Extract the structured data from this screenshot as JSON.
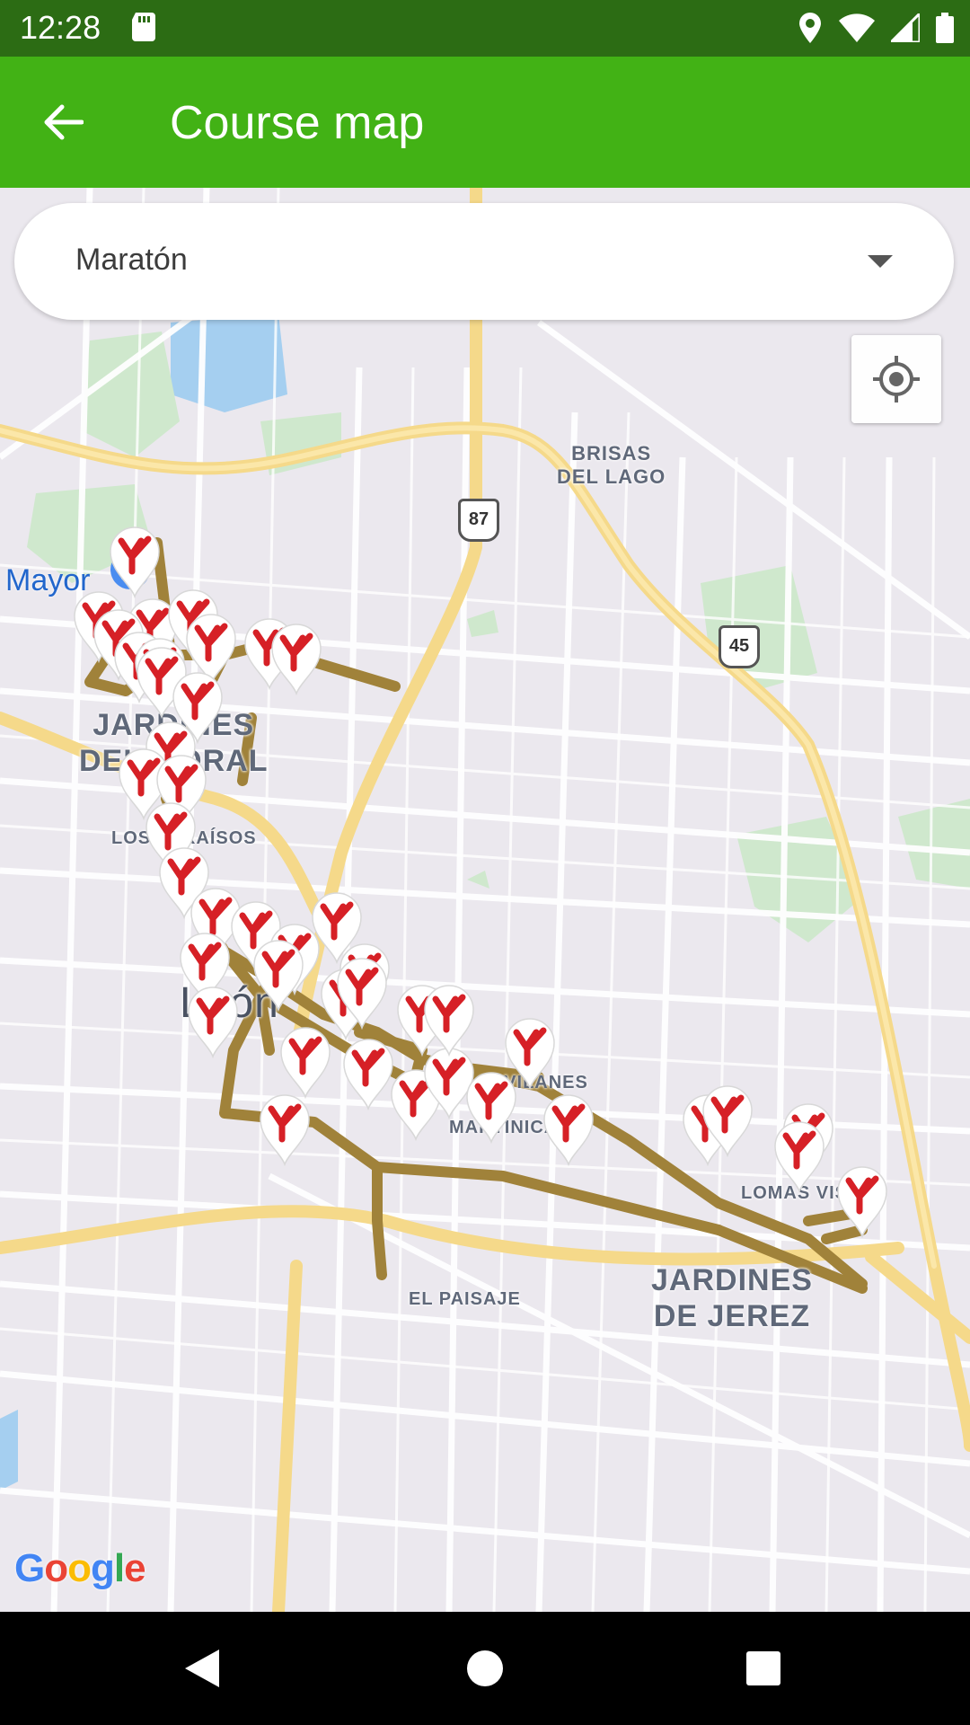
{
  "status_bar": {
    "time": "12:28",
    "icons": [
      "sd-card-icon",
      "location-icon",
      "wifi-icon",
      "signal-icon",
      "battery-icon"
    ]
  },
  "app_bar": {
    "title": "Course map",
    "back_icon": "arrow-left-icon"
  },
  "course_selector": {
    "selected": "Maratón"
  },
  "map": {
    "place_labels": {
      "brisas_del_lago": "BRISAS\nDEL LAGO",
      "jardines_del_moral": "JARDINES\nDEL MORAL",
      "los_paraisos": "LOS PARAÍSOS",
      "leon": "León",
      "los_gavilanes": "LOS GAVILANES",
      "martinica": "MARTINICA",
      "el_paisaje": "EL PAISAJE",
      "jardines_de_jerez": "JARDINES\nDE JEREZ",
      "lomas_vista": "LOMAS VISTA"
    },
    "poi_label": "Mayor",
    "highway_shields": [
      "87",
      "45"
    ],
    "attribution": "Google",
    "route_color": "#a0823a",
    "marker_color": "#d62026"
  },
  "nav_bar": {
    "icons": [
      "back-triangle-icon",
      "home-circle-icon",
      "recents-square-icon"
    ]
  }
}
